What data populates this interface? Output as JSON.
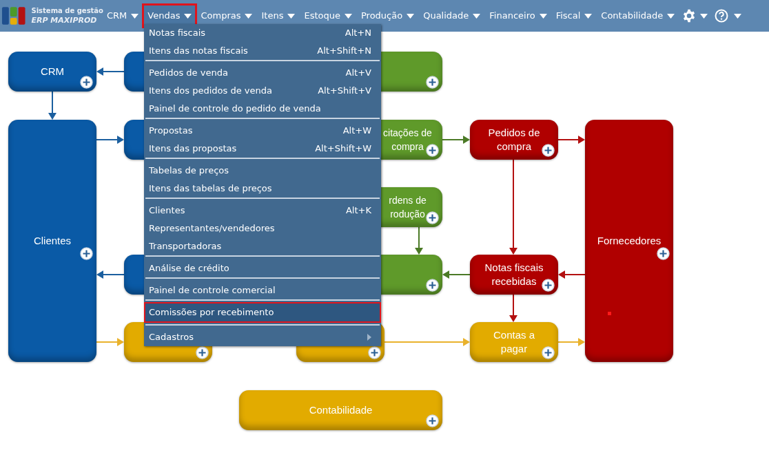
{
  "header": {
    "logo_line1": "Sistema de gestão",
    "logo_line2": "ERP MAXIPROD"
  },
  "nav": [
    {
      "label": "CRM",
      "selected": false
    },
    {
      "label": "Vendas",
      "selected": true
    },
    {
      "label": "Compras",
      "selected": false
    },
    {
      "label": "Itens",
      "selected": false
    },
    {
      "label": "Estoque",
      "selected": false
    },
    {
      "label": "Produção",
      "selected": false
    },
    {
      "label": "Qualidade",
      "selected": false
    },
    {
      "label": "Financeiro",
      "selected": false
    },
    {
      "label": "Fiscal",
      "selected": false
    },
    {
      "label": "Contabilidade",
      "selected": false
    }
  ],
  "menu": {
    "groups": [
      [
        {
          "label": "Notas fiscais",
          "shortcut": "Alt+N",
          "selected": false,
          "kind": "item"
        },
        {
          "label": "Itens das notas fiscais",
          "shortcut": "Alt+Shift+N",
          "selected": false,
          "kind": "item"
        }
      ],
      [
        {
          "label": "Pedidos de venda",
          "shortcut": "Alt+V",
          "selected": false,
          "kind": "item"
        },
        {
          "label": "Itens dos pedidos de venda",
          "shortcut": "Alt+Shift+V",
          "selected": false,
          "kind": "item"
        },
        {
          "label": "Painel de controle do pedido de venda",
          "selected": false,
          "kind": "item"
        }
      ],
      [
        {
          "label": "Propostas",
          "shortcut": "Alt+W",
          "selected": false,
          "kind": "item"
        },
        {
          "label": "Itens das propostas",
          "shortcut": "Alt+Shift+W",
          "selected": false,
          "kind": "item"
        }
      ],
      [
        {
          "label": "Tabelas de preços",
          "selected": false,
          "kind": "item"
        },
        {
          "label": "Itens das tabelas de preços",
          "selected": false,
          "kind": "item"
        }
      ],
      [
        {
          "label": "Clientes",
          "shortcut": "Alt+K",
          "selected": false,
          "kind": "item"
        },
        {
          "label": "Representantes/vendedores",
          "selected": false,
          "kind": "item"
        },
        {
          "label": "Transportadoras",
          "selected": false,
          "kind": "item"
        }
      ],
      [
        {
          "label": "Análise de crédito",
          "selected": false,
          "kind": "item"
        }
      ],
      [
        {
          "label": "Painel de controle comercial",
          "selected": false,
          "kind": "item"
        }
      ],
      [
        {
          "label": "Comissões por recebimento",
          "selected": true,
          "kind": "item"
        }
      ],
      [
        {
          "label": "Cadastros",
          "selected": false,
          "kind": "submenu"
        }
      ]
    ]
  },
  "diagram": {
    "nodes": [
      {
        "label": "CRM",
        "color": "#0a5aa6"
      },
      {
        "color": "#0a5aa6"
      },
      {
        "label": "Clientes",
        "color": "#0a5aa6"
      },
      {
        "color": "#0a5aa6"
      },
      {
        "color": "#0a5aa6"
      },
      {
        "color": "#e2ab00"
      },
      {
        "color": "#5f9a2a"
      },
      {
        "label": "citações de\ncompra",
        "color": "#5f9a2a"
      },
      {
        "label": "rdens de\nrodução",
        "color": "#5f9a2a"
      },
      {
        "color": "#5f9a2a"
      },
      {
        "color": "#e2ab00"
      },
      {
        "label": "Pedidos de\ncompra",
        "color": "#b00000"
      },
      {
        "label": "Notas fiscais\nrecebidas",
        "color": "#b00000"
      },
      {
        "label": "Contas a\npagar",
        "color": "#e2ab00"
      },
      {
        "label": "Fornecedores",
        "color": "#b00000"
      },
      {
        "label": "Contabilidade",
        "color": "#e2ab00"
      }
    ]
  }
}
